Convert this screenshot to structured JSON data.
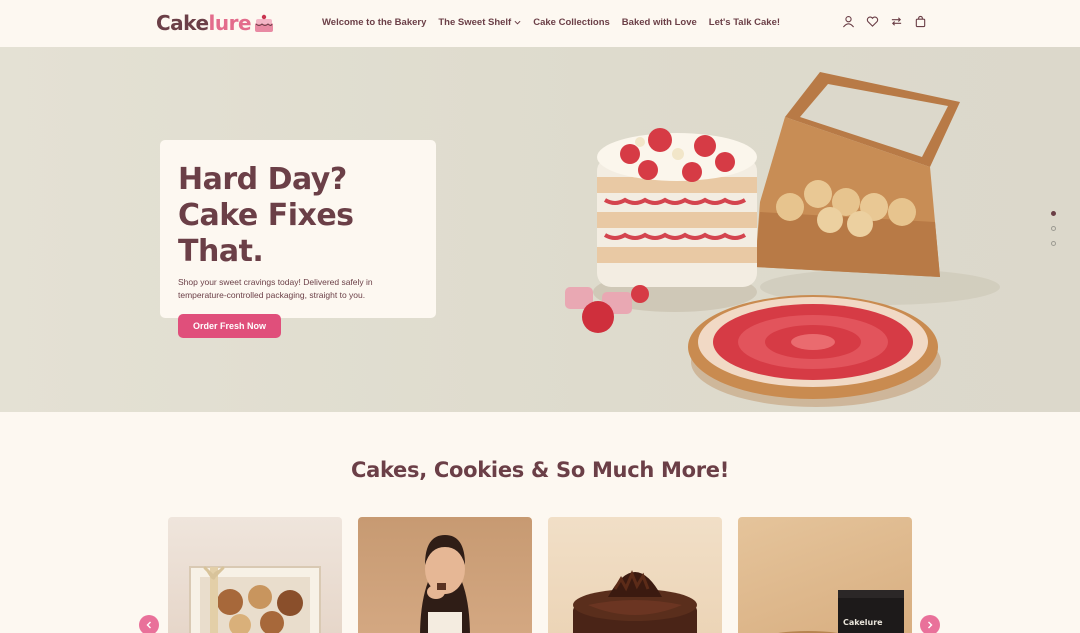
{
  "brand": {
    "name_part1": "Cake",
    "name_part2": "lure"
  },
  "nav": {
    "items": [
      {
        "label": "Welcome to the Bakery"
      },
      {
        "label": "The Sweet Shelf",
        "has_dropdown": true
      },
      {
        "label": "Cake Collections"
      },
      {
        "label": "Baked with Love"
      },
      {
        "label": "Let's Talk Cake!"
      }
    ]
  },
  "header_icons": [
    "user-icon",
    "heart-icon",
    "compare-icon",
    "cart-icon"
  ],
  "hero": {
    "title": "Hard Day? Cake Fixes That.",
    "subtitle": "Shop your sweet cravings today! Delivered safely in temperature-controlled packaging, straight to you.",
    "cta_label": "Order Fresh Now",
    "slides_total": 3,
    "active_slide": 1
  },
  "section": {
    "title": "Cakes, Cookies & So Much More!"
  },
  "products": {
    "cards": [
      {
        "icon": "gift-box-image"
      },
      {
        "icon": "woman-eating-chocolate-image"
      },
      {
        "icon": "chocolate-cake-image"
      },
      {
        "icon": "brand-box-image",
        "box_label": "Cakelure"
      }
    ]
  },
  "colors": {
    "brand_dark": "#6b3f47",
    "brand_pink": "#e36c8c",
    "cta": "#e04f7b",
    "background": "#fdf8f1"
  }
}
